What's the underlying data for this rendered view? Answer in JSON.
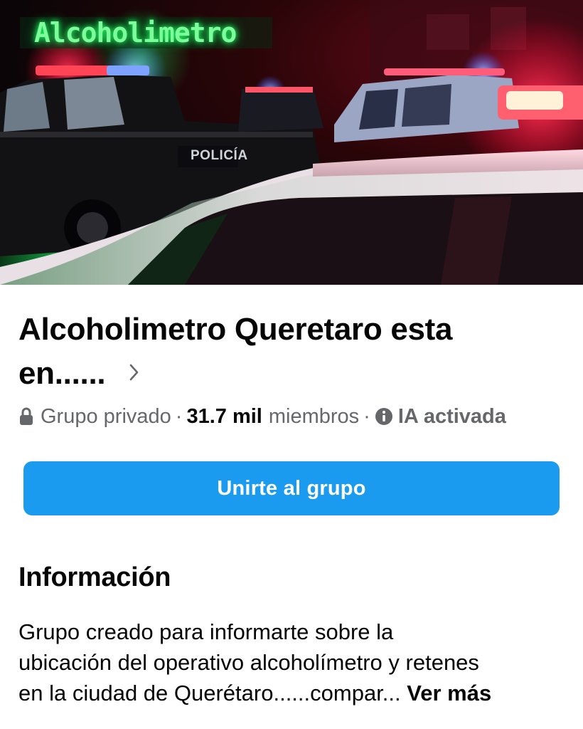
{
  "cover": {
    "sign_text": "Alcoholimetro",
    "vehicle_text": "POLICÍA",
    "photo_description": "night scene with police pickups and flashing lights"
  },
  "group": {
    "title": "Alcoholimetro Queretaro esta en......",
    "privacy_icon": "lock-icon",
    "privacy": "Grupo privado",
    "separator": "·",
    "member_count": "31.7 mil",
    "members_label": "miembros",
    "ai_icon": "info-icon",
    "ai_status": "IA activada"
  },
  "actions": {
    "join_label": "Unirte al grupo"
  },
  "about": {
    "heading": "Información",
    "lines": [
      "Grupo creado para informarte sobre la",
      "ubicación del operativo alcoholímetro y retenes",
      "en la ciudad de Querétaro......compar... "
    ],
    "see_more": "Ver más"
  },
  "colors": {
    "primary_button": "#1b9bf0",
    "secondary_text": "#65676b",
    "primary_text": "#050505"
  }
}
